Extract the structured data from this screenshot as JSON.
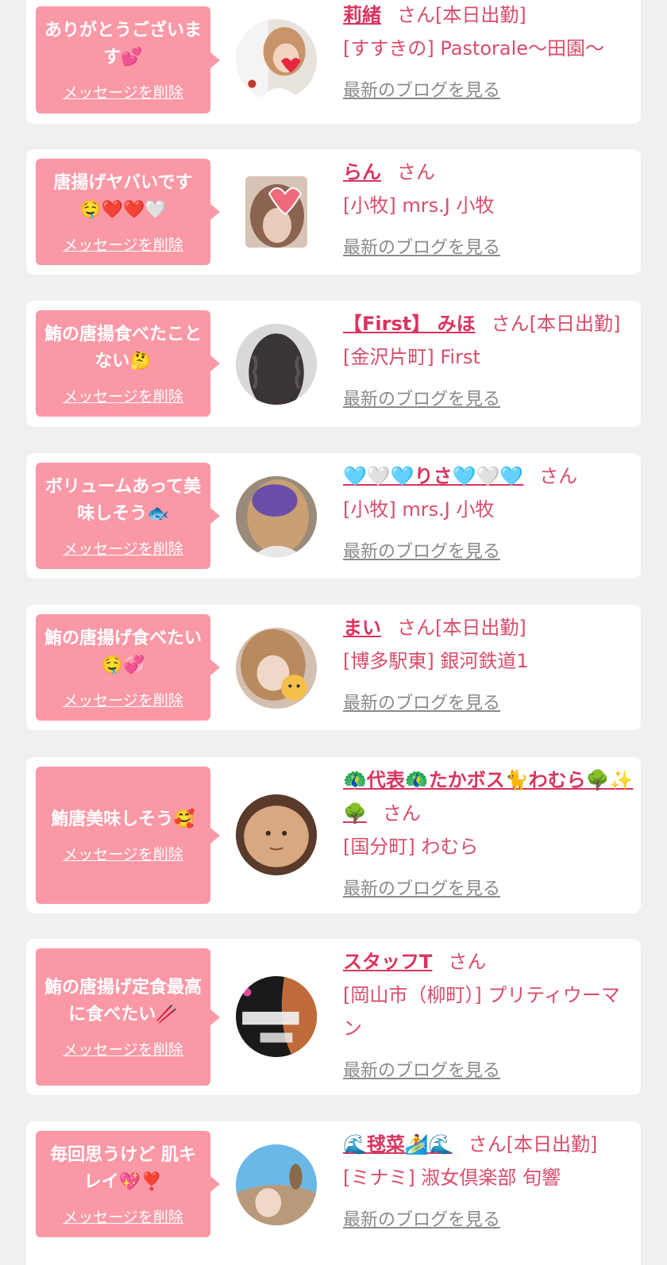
{
  "messages": [
    {
      "message": "ありがとうございます💕",
      "delete_label": "メッセージを削除",
      "name": "莉緒",
      "honorific": "さん[本日出勤]",
      "shop": "[すすきの] Pastorale～田園～",
      "blog_label": "最新のブログを見る"
    },
    {
      "message": "唐揚げヤバいです🤤❤️❤️🤍",
      "delete_label": "メッセージを削除",
      "name": "らん",
      "honorific": "さん",
      "shop": "[小牧] mrs.J 小牧",
      "blog_label": "最新のブログを見る"
    },
    {
      "message": "鮪の唐揚食べたことない🤔",
      "delete_label": "メッセージを削除",
      "name": "【First】 みほ",
      "honorific": "さん[本日出勤]",
      "shop": "[金沢片町] First",
      "blog_label": "最新のブログを見る"
    },
    {
      "message": "ボリュームあって美味しそう🐟",
      "delete_label": "メッセージを削除",
      "name": "🩵🤍🩵りさ🩵🤍🩵",
      "honorific": "さん",
      "shop": "[小牧] mrs.J 小牧",
      "blog_label": "最新のブログを見る"
    },
    {
      "message": "鮪の唐揚げ食べたい🤤💞",
      "delete_label": "メッセージを削除",
      "name": "まい",
      "honorific": "さん[本日出勤]",
      "shop": "[博多駅東] 銀河鉄道1",
      "blog_label": "最新のブログを見る"
    },
    {
      "message": "鮪唐美味しそう🥰",
      "delete_label": "メッセージを削除",
      "name": "🦚代表🦚たかボス🐈わむら🌳✨🌳",
      "honorific": "さん",
      "shop": "[国分町] わむら",
      "blog_label": "最新のブログを見る"
    },
    {
      "message": "鮪の唐揚げ定食最高に食べたい🥢",
      "delete_label": "メッセージを削除",
      "name": "スタッフT",
      "honorific": "さん",
      "shop": "[岡山市（柳町）] プリティウーマン",
      "blog_label": "最新のブログを見る"
    },
    {
      "message": "毎回思うけど 肌キレイ💖❣️",
      "delete_label": "メッセージを削除",
      "name": "🌊毬菜🏄🌊",
      "honorific": "さん[本日出勤]",
      "shop": "[ミナミ] 淑女倶楽部 旬響",
      "blog_label": "最新のブログを見る"
    }
  ],
  "colors": {
    "background": "#f0f0f0",
    "bubble": "#fb98a6",
    "name": "#d9345e",
    "text": "#d94c6a",
    "link": "#8a8a8a"
  }
}
